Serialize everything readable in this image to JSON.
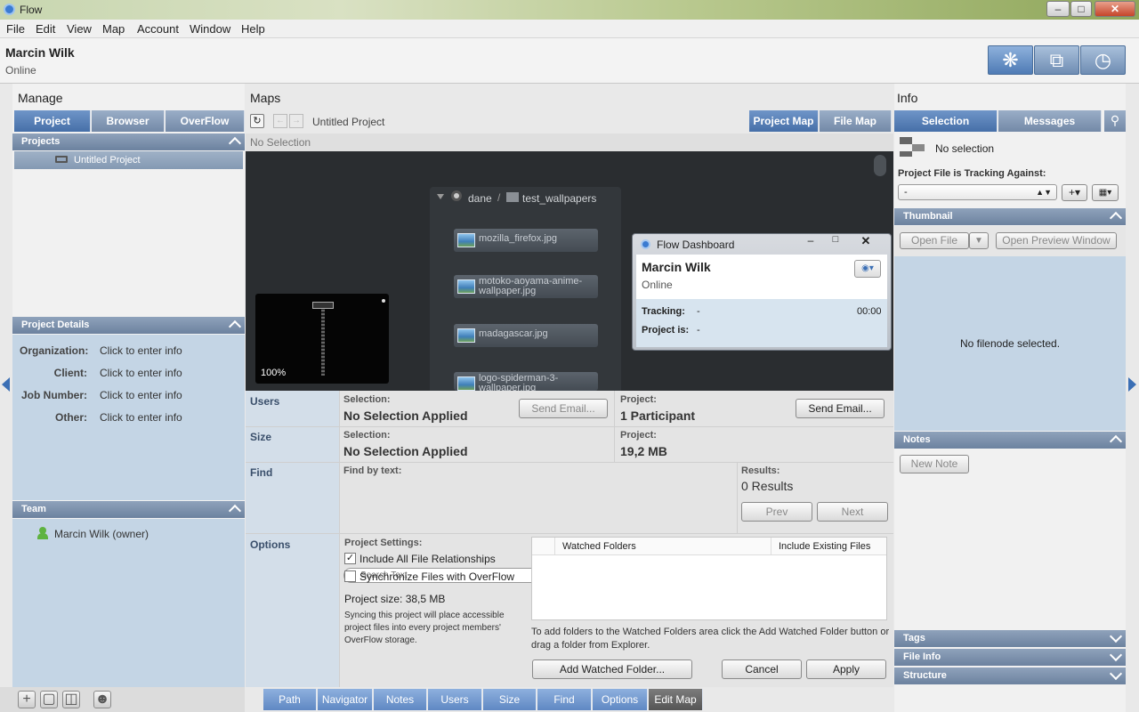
{
  "window": {
    "title": "Flow"
  },
  "menu": [
    "File",
    "Edit",
    "View",
    "Map",
    "Account",
    "Window",
    "Help"
  ],
  "user": {
    "name": "Marcin Wilk",
    "status": "Online"
  },
  "manage": {
    "title": "Manage",
    "tabs": [
      "Project",
      "Browser",
      "OverFlow"
    ],
    "projects_header": "Projects",
    "project_item": "Untitled Project",
    "details_header": "Project Details",
    "details": [
      {
        "label": "Organization:",
        "value": "Click to enter info"
      },
      {
        "label": "Client:",
        "value": "Click to enter info"
      },
      {
        "label": "Job Number:",
        "value": "Click to enter info"
      },
      {
        "label": "Other:",
        "value": "Click to enter info"
      }
    ],
    "team_header": "Team",
    "team_member": "Marcin Wilk (owner)"
  },
  "maps": {
    "title": "Maps",
    "project_name": "Untitled Project",
    "tabs": [
      "Project Map",
      "File Map"
    ],
    "selection": "No Selection",
    "zoom": "100%",
    "breadcrumb": {
      "root": "dane",
      "sep": "/",
      "folder": "test_wallpapers"
    },
    "files": [
      "mozilla_firefox.jpg",
      "motoko-aoyama-anime-wallpaper.jpg",
      "madagascar.jpg",
      "logo-spiderman-3-wallpaper.jpg"
    ]
  },
  "dashboard": {
    "title": "Flow Dashboard",
    "name": "Marcin Wilk",
    "status": "Online",
    "tracking_label": "Tracking:",
    "tracking_value": "-",
    "time": "00:00",
    "project_label": "Project is:",
    "project_value": "-"
  },
  "details": {
    "users": {
      "label": "Users",
      "sel_label": "Selection:",
      "sel_value": "No Selection Applied",
      "send_email_disabled": "Send Email...",
      "proj_label": "Project:",
      "proj_value": "1 Participant",
      "send_email": "Send Email..."
    },
    "size": {
      "label": "Size",
      "sel_label": "Selection:",
      "sel_value": "No Selection Applied",
      "proj_label": "Project:",
      "proj_value": "19,2 MB"
    },
    "find": {
      "label": "Find",
      "by_text": "Find by text:",
      "placeholder": "Search Text",
      "results_label": "Results:",
      "results_value": "0 Results",
      "prev": "Prev",
      "next": "Next"
    },
    "options": {
      "label": "Options",
      "settings": "Project Settings:",
      "include_rel": "Include All File Relationships",
      "sync": "Synchronize Files with OverFlow",
      "project_size": "Project size: 38,5 MB",
      "sync_note": "Syncing this project will place accessible project files into every project members' OverFlow storage.",
      "col_watched": "Watched Folders",
      "col_include": "Include Existing Files",
      "help": "To add folders to the Watched Folders area click the Add Watched Folder button or drag a folder from Explorer.",
      "add_folder": "Add Watched Folder...",
      "cancel": "Cancel",
      "apply": "Apply"
    }
  },
  "bottom_tabs": [
    "Path",
    "Navigator",
    "Notes",
    "Users",
    "Size",
    "Find",
    "Options",
    "Edit Map"
  ],
  "info": {
    "title": "Info",
    "tabs": [
      "Selection",
      "Messages"
    ],
    "no_selection": "No selection",
    "tracking_label": "Project File is Tracking Against:",
    "tracking_value": "-",
    "thumbnail_header": "Thumbnail",
    "open_file": "Open File",
    "open_preview": "Open Preview Window",
    "no_filenode": "No filenode selected.",
    "notes_header": "Notes",
    "new_note": "New Note",
    "tags_header": "Tags",
    "file_info_header": "File Info",
    "structure_header": "Structure"
  },
  "colors": {
    "accent": "#4f7bb5",
    "panel": "#c4d5e5",
    "map_bg": "#2a2d30"
  }
}
